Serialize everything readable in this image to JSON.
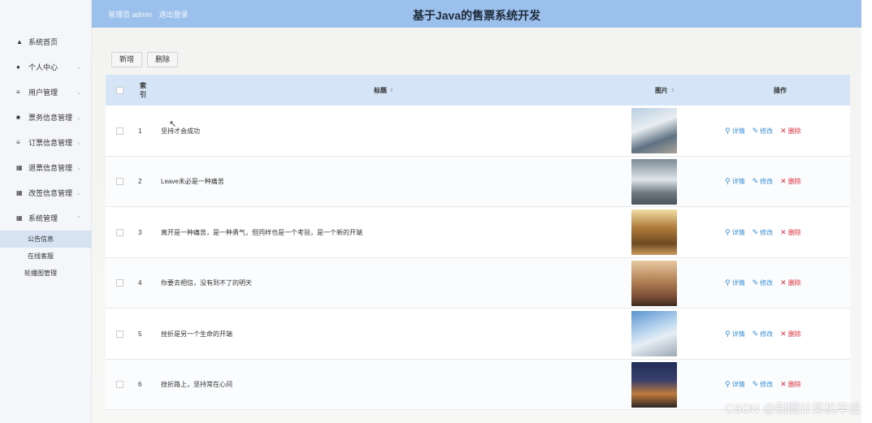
{
  "header": {
    "user_role": "管理员 admin",
    "logout": "退出登录",
    "title": "基于Java的售票系统开发"
  },
  "sidebar": {
    "items": [
      {
        "label": "系统首页",
        "icon": "home-icon",
        "has_arrow": false
      },
      {
        "label": "个人中心",
        "icon": "user-icon",
        "has_arrow": true
      },
      {
        "label": "用户管理",
        "icon": "sliders-icon",
        "has_arrow": true
      },
      {
        "label": "票务信息管理",
        "icon": "ticket-icon",
        "has_arrow": true
      },
      {
        "label": "订票信息管理",
        "icon": "list-icon",
        "has_arrow": true
      },
      {
        "label": "退票信息管理",
        "icon": "grid-icon",
        "has_arrow": true
      },
      {
        "label": "改签信息管理",
        "icon": "grid-icon",
        "has_arrow": true
      },
      {
        "label": "系统管理",
        "icon": "grid-icon",
        "has_arrow": true,
        "expanded": true
      }
    ],
    "submenu": [
      {
        "label": "公告信息",
        "active": true
      },
      {
        "label": "在线客服",
        "active": false
      },
      {
        "label": "轮播图管理",
        "active": false
      }
    ]
  },
  "toolbar": {
    "add_label": "新增",
    "delete_label": "删除"
  },
  "table": {
    "columns": {
      "index": "索引",
      "title": "标题",
      "image": "图片",
      "actions": "操作"
    },
    "rows": [
      {
        "index": "1",
        "title": "坚持才会成功",
        "image_theme": "train-platform"
      },
      {
        "index": "2",
        "title": "Leave未必是一种痛苦",
        "image_theme": "train-station"
      },
      {
        "index": "3",
        "title": "离开是一种痛苦，是一种勇气，但同样也是一个考验，是一个新的开端",
        "image_theme": "train-interior-warm"
      },
      {
        "index": "4",
        "title": "你要去相信，没有到不了的明天",
        "image_theme": "train-interior-aisle"
      },
      {
        "index": "5",
        "title": "挫折是另一个生命的开端",
        "image_theme": "train-sky"
      },
      {
        "index": "6",
        "title": "挫折路上，坚持常在心间",
        "image_theme": "city-night"
      }
    ],
    "actions": {
      "detail": "详情",
      "edit": "修改",
      "delete": "删除"
    }
  },
  "watermark": "CSDN @别圆计算机毕设",
  "colors": {
    "header_bg": "#9cc0ec",
    "table_head_bg": "#d5e5f7",
    "action_blue": "#3a8fd8",
    "action_red": "#e0303a"
  }
}
